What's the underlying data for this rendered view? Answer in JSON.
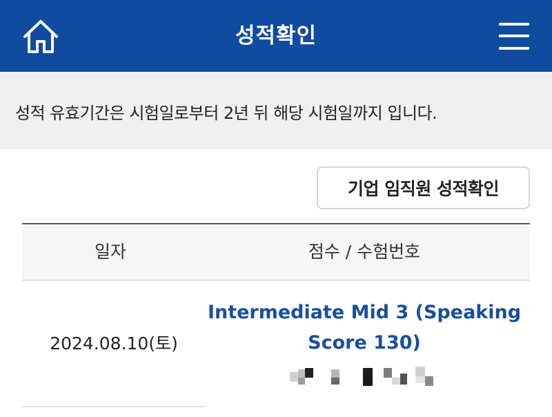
{
  "header": {
    "title": "성적확인",
    "home_icon": "home-icon",
    "menu_icon": "hamburger-menu-icon",
    "background_color": "#0f4ca0"
  },
  "notice": {
    "text": "성적 유효기간은 시험일로부터 2년 뒤 해당 시험일까지 입니다."
  },
  "corporate_button": {
    "label": "기업 임직원 성적확인"
  },
  "table": {
    "columns": [
      "일자",
      "점수 / 수험번호"
    ],
    "rows": [
      {
        "date": "2024.08.10(토)",
        "score": "Intermediate Mid 3 (Speaking Score 130)",
        "exam_number": "[pixelated]"
      }
    ]
  },
  "colors": {
    "accent": "#0f4ca0",
    "score_link": "#1a4e9e",
    "notice_bg": "#f0f0f0"
  }
}
